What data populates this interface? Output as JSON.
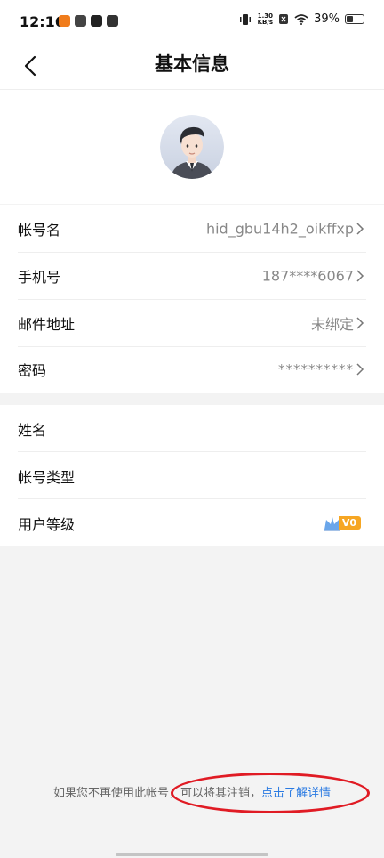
{
  "status_bar": {
    "time": "12:16",
    "net_speed_value": "1.30",
    "net_speed_unit": "KB/s",
    "battery": "39%"
  },
  "header": {
    "title": "基本信息"
  },
  "account": {
    "rows": [
      {
        "label": "帐号名",
        "value": "hid_gbu14h2_oikffxp"
      },
      {
        "label": "手机号",
        "value": "187****6067"
      },
      {
        "label": "邮件地址",
        "value": "未绑定"
      },
      {
        "label": "密码",
        "value": "**********"
      }
    ]
  },
  "profile": {
    "rows": [
      {
        "label": "姓名",
        "value": ""
      },
      {
        "label": "帐号类型",
        "value": ""
      },
      {
        "label": "用户等级",
        "value": "V0"
      }
    ]
  },
  "footer": {
    "text": "如果您不再使用此帐号，可以将其注销，",
    "link": "点击了解详情"
  },
  "colors": {
    "accent_link": "#2a7ae2",
    "annotation_red": "#e01b24",
    "level_badge": "#f6a623"
  }
}
